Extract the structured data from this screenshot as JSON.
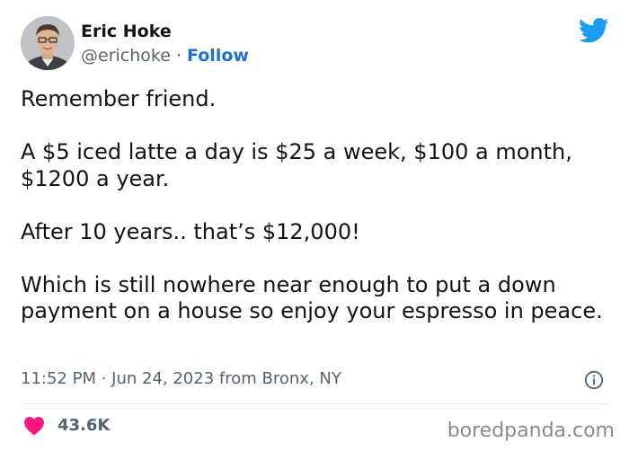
{
  "author": {
    "name": "Eric Hoke",
    "handle": "@erichoke",
    "separator": " · ",
    "follow_label": "Follow"
  },
  "tweet": {
    "paragraphs": [
      "Remember friend.",
      "A $5 iced latte a day is $25 a week, $100 a month, $1200 a year.",
      "After 10 years.. that’s $12,000!",
      "Which is still nowhere near enough to put a down payment on a house so enjoy your espresso in peace."
    ],
    "time": "11:52 PM",
    "date": "Jun 24, 2023",
    "location_text": "from Bronx, NY",
    "meta_separator": " · "
  },
  "engagement": {
    "likes": "43.6K"
  },
  "watermark": "boredpanda.com",
  "icons": {
    "brand": "twitter-bird-icon",
    "info": "info-icon",
    "like": "heart-icon"
  },
  "colors": {
    "twitter_blue": "#1d9bf0",
    "follow_blue": "#1d72c7",
    "heart_pink": "#f91880",
    "secondary_text": "#536471"
  }
}
